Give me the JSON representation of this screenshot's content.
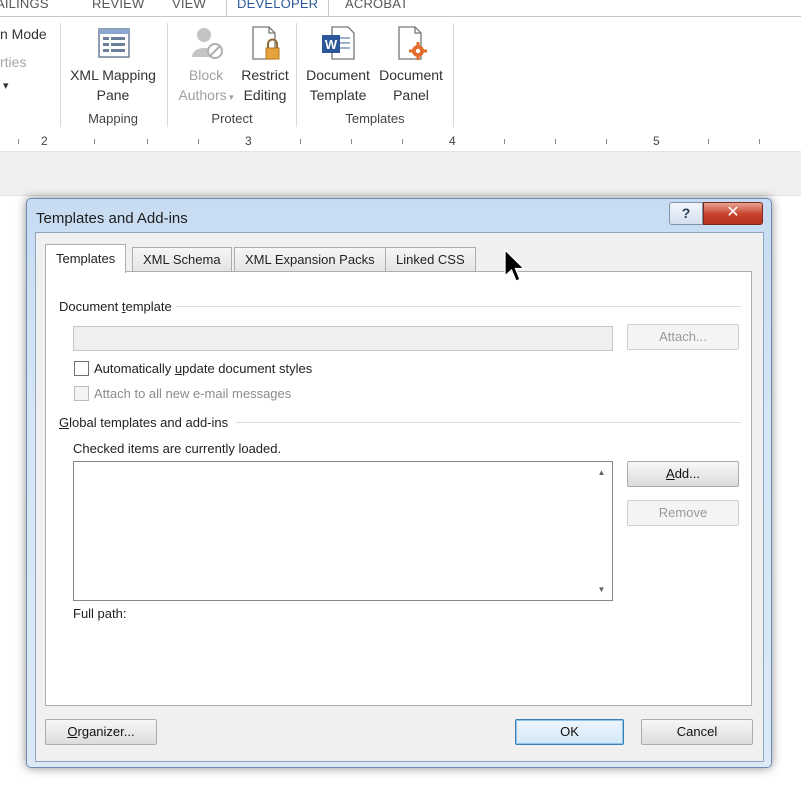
{
  "ribbon": {
    "tabs": [
      "AILINGS",
      "REVIEW",
      "VIEW",
      "DEVELOPER",
      "ACROBAT"
    ],
    "active_tab": "DEVELOPER",
    "partial_items": {
      "mode": "n Mode",
      "properties": "rties",
      "dropdown": "▾"
    },
    "groups": {
      "mapping": {
        "label": "Mapping",
        "xml_mapping_pane": {
          "line1": "XML Mapping",
          "line2": "Pane"
        }
      },
      "protect": {
        "label": "Protect",
        "block_authors": {
          "line1": "Block",
          "line2": "Authors"
        },
        "restrict_editing": {
          "line1": "Restrict",
          "line2": "Editing"
        }
      },
      "templates": {
        "label": "Templates",
        "document_template": {
          "line1": "Document",
          "line2": "Template"
        },
        "document_panel": {
          "line1": "Document",
          "line2": "Panel"
        }
      }
    }
  },
  "ruler": {
    "numbers": [
      "2",
      "3",
      "4",
      "5"
    ]
  },
  "dialog": {
    "title": "Templates and Add-ins",
    "help_glyph": "?",
    "close_glyph": "✕",
    "tabs": [
      "Templates",
      "XML Schema",
      "XML Expansion Packs",
      "Linked CSS"
    ],
    "active_tab": "Templates",
    "document_template": {
      "label_pre": "Document ",
      "label_ul": "t",
      "label_post": "emplate",
      "value": "",
      "attach_button": "Attach..."
    },
    "checkboxes": {
      "auto_update": {
        "pre": "Automatically ",
        "ul": "u",
        "post": "pdate document styles",
        "checked": false,
        "enabled": true
      },
      "attach_email": {
        "label": "Attach to all new e-mail messages",
        "checked": false,
        "enabled": false
      }
    },
    "global_templates": {
      "label_ul": "G",
      "label_post": "lobal templates and add-ins",
      "hint": "Checked items are currently loaded.",
      "items": [],
      "add_button": {
        "pre": "",
        "ul": "A",
        "post": "dd..."
      },
      "remove_button": "Remove"
    },
    "full_path_label": "Full path:",
    "footer": {
      "organizer_button": {
        "ul": "O",
        "post": "rganizer..."
      },
      "ok_button": "OK",
      "cancel_button": "Cancel"
    }
  }
}
